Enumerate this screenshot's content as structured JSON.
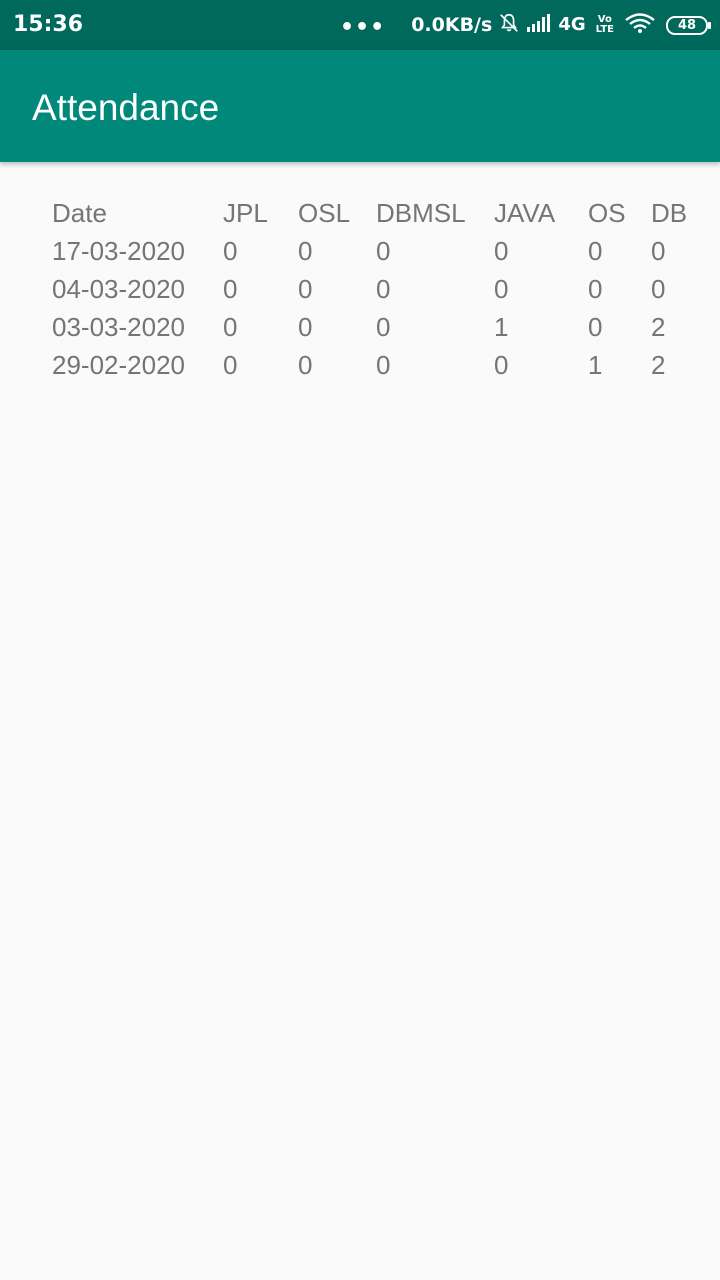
{
  "status_bar": {
    "time": "15:36",
    "dots": "•••",
    "speed": "0.0KB/s",
    "network": "4G",
    "volte_top": "Vo",
    "volte_bottom": "LTE",
    "battery": "48"
  },
  "app_bar": {
    "title": "Attendance"
  },
  "table": {
    "headers": [
      "Date",
      "JPL",
      "OSL",
      "DBMSL",
      "JAVA",
      "OS",
      "DB"
    ],
    "rows": [
      [
        "17-03-2020",
        "0",
        "0",
        "0",
        "0",
        "0",
        "0"
      ],
      [
        "04-03-2020",
        "0",
        "0",
        "0",
        "0",
        "0",
        "0"
      ],
      [
        "03-03-2020",
        "0",
        "0",
        "0",
        "1",
        "0",
        "2"
      ],
      [
        "29-02-2020",
        "0",
        "0",
        "0",
        "0",
        "1",
        "2"
      ]
    ]
  }
}
